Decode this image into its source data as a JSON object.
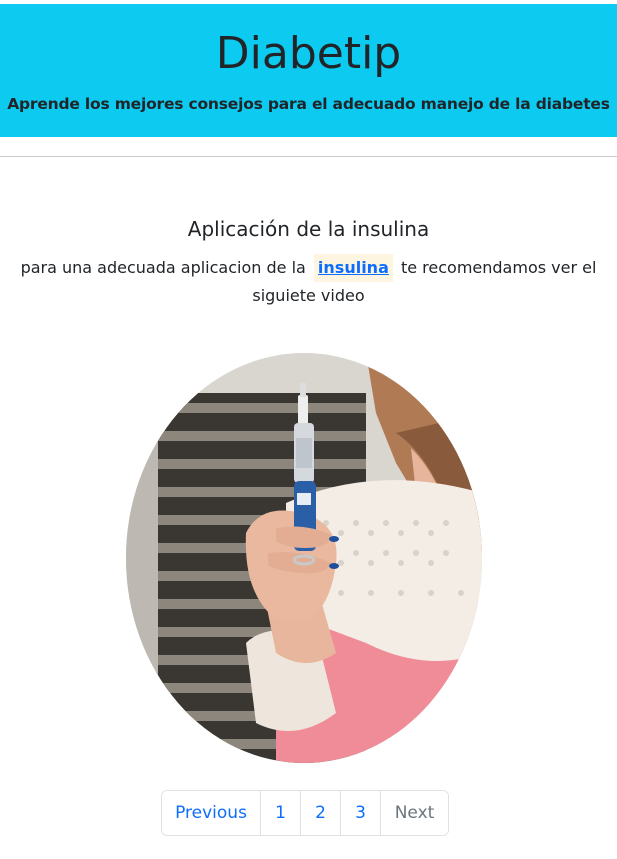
{
  "header": {
    "title": "Diabetip",
    "subtitle": "Aprende los mejores consejos para el adecuado manejo de la diabetes",
    "background_color": "#0dcaf0"
  },
  "section": {
    "title": "Aplicación de la insulina",
    "description_before": "para una adecuada aplicacion de la",
    "link_text": "insulina",
    "description_after": "te recomendamos ver el siguiete video"
  },
  "image": {
    "subject": "hand holding insulin pen"
  },
  "pagination": {
    "previous": "Previous",
    "pages": [
      "1",
      "2",
      "3"
    ],
    "next": "Next"
  },
  "colors": {
    "link": "#0d6efd",
    "disabled": "#6c757d",
    "link_highlight": "#fdf5e0"
  }
}
